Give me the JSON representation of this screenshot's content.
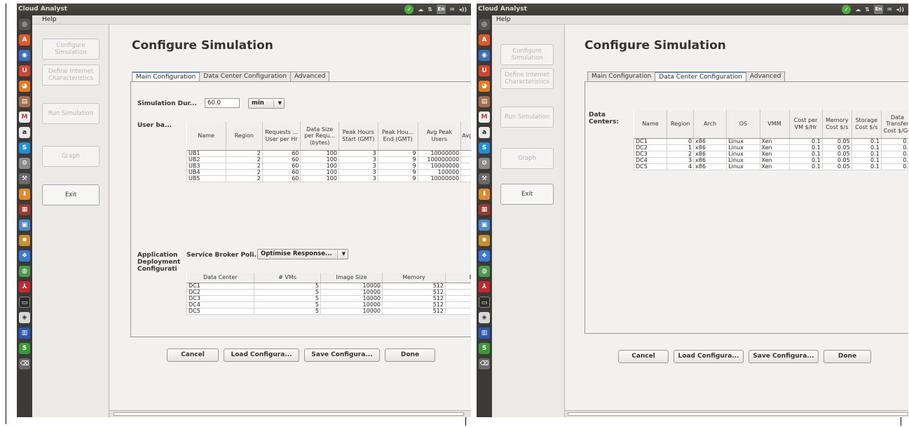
{
  "left_window": {
    "title": "Cloud Analyst",
    "menu": "Help",
    "tray": {
      "lang": "En",
      "volume": "◂))"
    },
    "nav": [
      "Configure Simulation",
      "Define Internet Characteristics",
      "Run Simulation",
      "Graph",
      "Exit"
    ],
    "page_title": "Configure Simulation",
    "tabs": [
      "Main Configuration",
      "Data Center Configuration",
      "Advanced"
    ],
    "duration_label": "Simulation Dur...",
    "duration_value": "60.0",
    "duration_unit": "min",
    "userbase_label": "User ba...",
    "userbase_headers": [
      "Name",
      "Region",
      "Requests ... User per Hr",
      "Data Size per Requ... (bytes)",
      "Peak Hours Start (GMT)",
      "Peak Hou... End (GMT)",
      "Avg Peak Users",
      "Avg U"
    ],
    "userbase_rows": [
      [
        "UB1",
        "2",
        "60",
        "100",
        "3",
        "9",
        "10000000"
      ],
      [
        "UB2",
        "2",
        "60",
        "100",
        "3",
        "9",
        "100000000"
      ],
      [
        "UB3",
        "2",
        "60",
        "100",
        "3",
        "9",
        "10000000"
      ],
      [
        "UB4",
        "2",
        "60",
        "100",
        "3",
        "9",
        "100000"
      ],
      [
        "UB5",
        "2",
        "60",
        "100",
        "3",
        "9",
        "10000000"
      ]
    ],
    "app_label": "Application Deployment Configurati",
    "broker_label": "Service Broker Poli...",
    "broker_value": "Optimise Response...",
    "app_headers": [
      "Data Center",
      "# VMs",
      "Image Size",
      "Memory",
      "B"
    ],
    "app_rows": [
      [
        "DC1",
        "5",
        "10000",
        "512"
      ],
      [
        "DC2",
        "5",
        "10000",
        "512"
      ],
      [
        "DC3",
        "5",
        "10000",
        "512"
      ],
      [
        "DC4",
        "5",
        "10000",
        "512"
      ],
      [
        "DC5",
        "5",
        "10000",
        "512"
      ]
    ],
    "buttons": [
      "Cancel",
      "Load Configura...",
      "Save Configura...",
      "Done"
    ]
  },
  "right_window": {
    "title": "Cloud Analyst",
    "menu": "Help",
    "tray": {
      "lang": "En",
      "volume": "◂))"
    },
    "nav": [
      "Configure Simulation",
      "Define Internet Characteristics",
      "Run Simulation",
      "Graph",
      "Exit"
    ],
    "page_title": "Configure Simulation",
    "tabs": [
      "Main Configuration",
      "Data Center Configuration",
      "Advanced"
    ],
    "dc_label": "Data Centers:",
    "dc_headers": [
      "Name",
      "Region",
      "Arch",
      "OS",
      "VMM",
      "Cost per VM $/Hr",
      "Memory Cost $/s",
      "Storage Cost $/s",
      "Data Transfer Cost $/Gb"
    ],
    "dc_rows": [
      [
        "DC1",
        "0",
        "x86",
        "Linux",
        "Xen",
        "0.1",
        "0.05",
        "0.1",
        "0.1"
      ],
      [
        "DC2",
        "1",
        "x86",
        "Linux",
        "Xen",
        "0.1",
        "0.05",
        "0.1",
        "0.1"
      ],
      [
        "DC3",
        "2",
        "x86",
        "Linux",
        "Xen",
        "0.1",
        "0.05",
        "0.1",
        "0.1"
      ],
      [
        "DC4",
        "3",
        "x86",
        "Linux",
        "Xen",
        "0.1",
        "0.05",
        "0.1",
        "0.1"
      ],
      [
        "DC5",
        "4",
        "x86",
        "Linux",
        "Xen",
        "0.1",
        "0.05",
        "0.1",
        "0.1"
      ]
    ],
    "buttons": [
      "Cancel",
      "Load Configura...",
      "Save Configura...",
      "Done"
    ]
  },
  "launcher_icons": [
    "dash-home-icon",
    "software-center-icon",
    "network-icon",
    "ubuntu-one-icon",
    "firefox-icon",
    "files-icon",
    "gmail-icon",
    "amazon-icon",
    "skype-icon",
    "settings-icon",
    "system-tools-icon",
    "install-icon",
    "archive-icon",
    "calculator-icon",
    "preferences-icon",
    "updates-icon",
    "browser-icon",
    "pdf-icon",
    "terminal-icon",
    "screenshot-icon",
    "workspaces-icon",
    "netbeans-icon",
    "trash-icon"
  ]
}
